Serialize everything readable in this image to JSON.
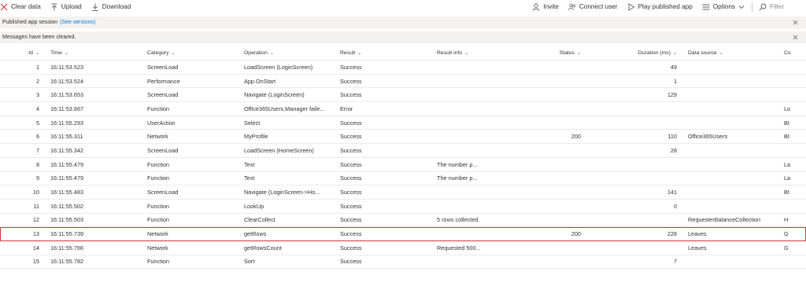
{
  "toolbar": {
    "clear_data": "Clear data",
    "upload": "Upload",
    "download": "Download",
    "invite": "Invite",
    "connect_user": "Connect user",
    "play_published_app": "Play published app",
    "options": "Options",
    "filter_placeholder": "Filter"
  },
  "banners": {
    "session_text": "Published app session",
    "session_link": "(See versions)",
    "cleared_text": "Messages have been cleared."
  },
  "columns": {
    "id": "Id",
    "time": "Time",
    "category": "Category",
    "operation": "Operation",
    "result": "Result",
    "result_info": "Result info",
    "status": "Status",
    "duration": "Duration (ms)",
    "data_source": "Data source",
    "co": "Co"
  },
  "rows": [
    {
      "id": "1",
      "time": "16:11:53.523",
      "category": "ScreenLoad",
      "operation": "LoadScreen (LoginScreen)",
      "result": "Success",
      "info": "",
      "status": "",
      "duration": "49",
      "ds": "",
      "co": ""
    },
    {
      "id": "2",
      "time": "16:11:53.524",
      "category": "Performance",
      "operation": "App.OnStart",
      "result": "Success",
      "info": "",
      "status": "",
      "duration": "1",
      "ds": "",
      "co": ""
    },
    {
      "id": "3",
      "time": "16:11:53.653",
      "category": "ScreenLoad",
      "operation": "Navigate (LoginScreen)",
      "result": "Success",
      "info": "",
      "status": "",
      "duration": "129",
      "ds": "",
      "co": ""
    },
    {
      "id": "4",
      "time": "16:11:53.667",
      "category": "Function",
      "operation": "Office365Users.Manager faile...",
      "result": "Error",
      "info": "",
      "status": "",
      "duration": "",
      "ds": "",
      "co": "Lo"
    },
    {
      "id": "5",
      "time": "16:11:55.293",
      "category": "UserAction",
      "operation": "Select",
      "result": "Success",
      "info": "",
      "status": "",
      "duration": "",
      "ds": "",
      "co": "Bt"
    },
    {
      "id": "6",
      "time": "16:11:55.311",
      "category": "Network",
      "operation": "MyProfile",
      "result": "Success",
      "info": "",
      "status": "200",
      "duration": "110",
      "ds": "Office365Users",
      "co": "Bt"
    },
    {
      "id": "7",
      "time": "16:11:55.342",
      "category": "ScreenLoad",
      "operation": "LoadScreen (HomeScreen)",
      "result": "Success",
      "info": "",
      "status": "",
      "duration": "28",
      "ds": "",
      "co": ""
    },
    {
      "id": "8",
      "time": "16:11:55.479",
      "category": "Function",
      "operation": "Text",
      "result": "Success",
      "info": "The number p...",
      "status": "",
      "duration": "",
      "ds": "",
      "co": "La"
    },
    {
      "id": "9",
      "time": "16:11:55.479",
      "category": "Function",
      "operation": "Text",
      "result": "Success",
      "info": "The number p...",
      "status": "",
      "duration": "",
      "ds": "",
      "co": "La"
    },
    {
      "id": "10",
      "time": "16:11:55.483",
      "category": "ScreenLoad",
      "operation": "Navigate (LoginScreen->Ho...",
      "result": "Success",
      "info": "",
      "status": "",
      "duration": "141",
      "ds": "",
      "co": "Bt"
    },
    {
      "id": "11",
      "time": "16:11:55.502",
      "category": "Function",
      "operation": "LookUp",
      "result": "Success",
      "info": "",
      "status": "",
      "duration": "0",
      "ds": "",
      "co": ""
    },
    {
      "id": "12",
      "time": "16:11:55.503",
      "category": "Function",
      "operation": "ClearCollect",
      "result": "Success",
      "info": "5 rows collected.",
      "status": "",
      "duration": "",
      "ds": "RequesterBalanceCollection",
      "co": "H"
    },
    {
      "id": "13",
      "time": "16:11:55.739",
      "category": "Network",
      "operation": "getRows",
      "result": "Success",
      "info": "",
      "status": "200",
      "duration": "228",
      "ds": "Leaves",
      "co": "G"
    },
    {
      "id": "14",
      "time": "16:11:55.766",
      "category": "Network",
      "operation": "getRowsCount",
      "result": "Success",
      "info": "Requested 500...",
      "status": "",
      "duration": "",
      "ds": "Leaves",
      "co": "G"
    },
    {
      "id": "15",
      "time": "16:11:55.782",
      "category": "Function",
      "operation": "Sort",
      "result": "Success",
      "info": "",
      "status": "",
      "duration": "7",
      "ds": "",
      "co": ""
    }
  ],
  "selected_row_id": "13",
  "colors": {
    "accent": "#0078d4",
    "banner_bg": "#f3f2f1",
    "selected_outline": "#d13438",
    "clear_icon": "#d13438"
  }
}
